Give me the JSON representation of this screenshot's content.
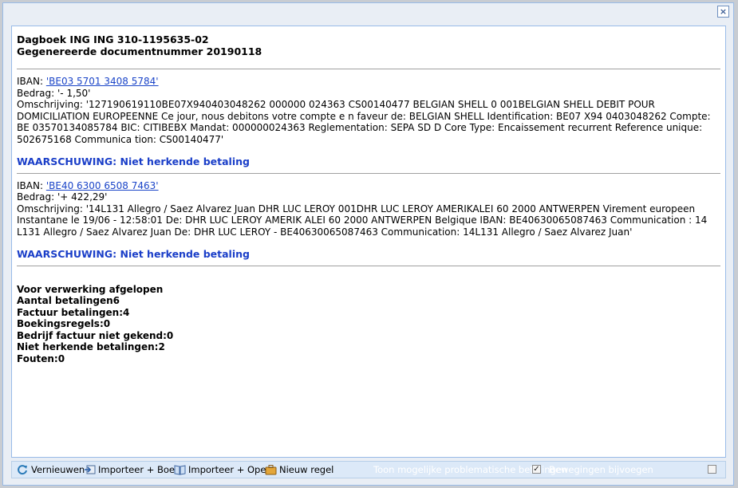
{
  "dialog": {
    "close_label": "×"
  },
  "report": {
    "title": "Dagboek ING ING 310-1195635-02",
    "subtitle": "Gegenereerde documentnummer 20190118",
    "payments": [
      {
        "iban_label": "IBAN: ",
        "iban_link": "'BE03 5701 3408 5784'",
        "amount": "Bedrag: '- 1,50'",
        "description": "Omschrijving: '127190619110BE07X940403048262 000000 024363 CS00140477 BELGIAN SHELL 0 001BELGIAN SHELL DEBIT POUR DOMICILIATION EUROPEENNE Ce jour, nous debitons votre compte e n faveur de: BELGIAN SHELL Identification: BE07 X94 0403048262 Compte: BE 03570134085784 BIC: CITIBEBX Mandat: 000000024363 Reglementation: SEPA SD D Core Type: Encaissement recurrent Reference unique: 502675168 Communica tion: CS00140477'",
        "warning": "WAARSCHUWING: Niet herkende betaling"
      },
      {
        "iban_label": "IBAN: ",
        "iban_link": "'BE40 6300 6508 7463'",
        "amount": "Bedrag: '+ 422,29'",
        "description": "Omschrijving: '14L131 Allegro / Saez Alvarez Juan DHR LUC LEROY 001DHR LUC LEROY AMERIKALEI 60 2000 ANTWERPEN Virement europeen Instantane le 19/06 - 12:58:01 De: DHR LUC LEROY AMERIK ALEI 60 2000 ANTWERPEN Belgique IBAN: BE40630065087463 Communication : 14 L131 Allegro / Saez Alvarez Juan De: DHR LUC LEROY - BE40630065087463 Communication: 14L131 Allegro / Saez Alvarez Juan'",
        "warning": "WAARSCHUWING: Niet herkende betaling"
      }
    ],
    "summary": [
      "Voor verwerking afgelopen",
      "Aantal betalingen6",
      "Factuur betalingen:4",
      "Boekingsregels:0",
      "Bedrijf factuur niet gekend:0",
      "Niet herkende betalingen:2",
      "Fouten:0"
    ]
  },
  "toolbar": {
    "refresh_label": "Vernieuwen",
    "import_book_label": "Importeer + Boek",
    "import_open_label": "Importeer + Open",
    "new_line_label": "Nieuw regel",
    "problematic_label": "Toon mogelijke problematische betalingen",
    "problematic_checked": true,
    "add_movements_label": "Bewegingen bijvoegen",
    "add_movements_checked": false
  },
  "colors": {
    "link": "#1a44c8",
    "warning": "#1a3ec8",
    "dialog_border": "#99bbe8",
    "toolbar_bg": "#dce9f8"
  }
}
